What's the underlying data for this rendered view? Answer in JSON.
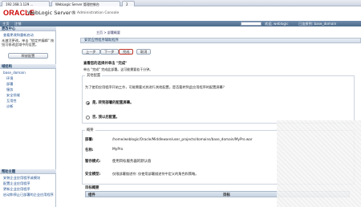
{
  "browser": {
    "tabs": [
      {
        "label": "192.168.1.129 ..."
      },
      {
        "label": "WebLogic Server 管理控制台"
      },
      {
        "label": "2"
      }
    ]
  },
  "header": {
    "logo": "ORACLE",
    "product": "WebLogic Server®",
    "subproduct": "Administration Console"
  },
  "toolbar": {
    "items": [
      "主页",
      "注销"
    ],
    "welcome": "欢迎, weblogic",
    "connected": "已连接到: base_domain"
  },
  "sidebar": {
    "change_center_title": "更改中心",
    "view_changes": "查看更改和重新启动",
    "pending_text": "未激活更改。单击 \"锁定并编辑\" 按钮可修改此域中的设置。",
    "lock_button": "释放配置",
    "domain_structure_title": "域结构",
    "tree_items": [
      "base_domain",
      "环境",
      "部署",
      "服务",
      "安全领域",
      "互用性",
      "诊断"
    ],
    "help_title": "帮助主题",
    "help_items": [
      "安装企业应用程序或模块",
      "配置企业应用程序",
      "更新企业应用程序",
      "启动和停止已部署的企业应用程序"
    ]
  },
  "main": {
    "breadcrumb": "主页 > 部署概要",
    "section_title": "安装应用程序辅助程序",
    "buttons": {
      "back": "上一步",
      "next": "下一步",
      "finish": "完成",
      "cancel": "取消"
    },
    "review_title": "查看您的选择并单击 \"完成\"",
    "review_desc": "单击 \"完成\" 完成此部署。这可能需要若干分钟。",
    "additional_config_legend": "其他配置",
    "additional_question": "为了使用应用程序开始工作，可能需要对其进行其他配置。是否要转到此应用程序的配置屏幕？",
    "radio_yes": "是, 转到部署的配置屏幕。",
    "radio_no": "否, 我以后配置。",
    "summary_legend": "概要",
    "summary": [
      {
        "key": "部署:",
        "value": "/home/weblogic/Oracle/Middleware/user_projects/domains/base_domain/MyPro.war"
      },
      {
        "key": "名称:",
        "value": "MyPro"
      },
      {
        "key": "暂存模式:",
        "value": "使用目标服务器的默认值"
      },
      {
        "key": "安全模型:",
        "value": "仅限部署描述符: 仅使用部署描述符中定义的角色和策略。"
      }
    ],
    "target_summary_title": "目标概要",
    "target_columns": [
      "组件",
      "目标"
    ]
  }
}
